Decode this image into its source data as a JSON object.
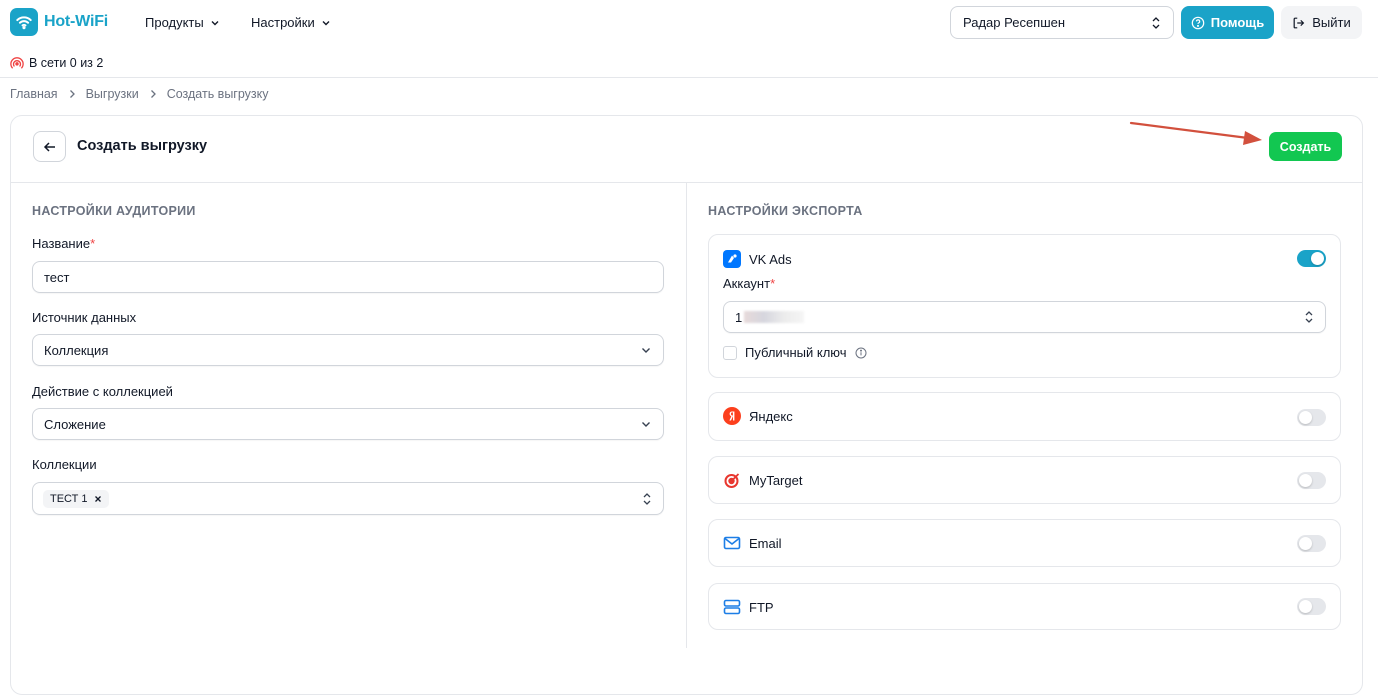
{
  "app": {
    "name": "Hot-WiFi"
  },
  "nav": {
    "products": "Продукты",
    "settings": "Настройки"
  },
  "venue": {
    "selected": "Радар Ресепшен"
  },
  "header": {
    "help": "Помощь",
    "logout": "Выйти"
  },
  "status": {
    "text": "В сети 0 из 2"
  },
  "breadcrumb": {
    "items": [
      "Главная",
      "Выгрузки",
      "Создать выгрузку"
    ]
  },
  "page": {
    "title": "Создать выгрузку",
    "create": "Создать"
  },
  "audience": {
    "title": "НАСТРОЙКИ АУДИТОРИИ",
    "name_label": "Название",
    "name_value": "тест",
    "source_label": "Источник данных",
    "source_value": "Коллекция",
    "action_label": "Действие с коллекцией",
    "action_value": "Сложение",
    "collections_label": "Коллекции",
    "collections_chip": "ТЕСТ 1",
    "required_mark": "*"
  },
  "export": {
    "title": "НАСТРОЙКИ ЭКСПОРТА",
    "vk": {
      "name": "VK Ads",
      "enabled": true,
      "account_label": "Аккаунт",
      "account_value": "1",
      "public_key": "Публичный ключ"
    },
    "yandex": {
      "name": "Яндекс",
      "enabled": false
    },
    "mytarget": {
      "name": "MyTarget",
      "enabled": false
    },
    "email": {
      "name": "Email",
      "enabled": false
    },
    "ftp": {
      "name": "FTP",
      "enabled": false
    }
  },
  "colors": {
    "brand": "#1aa3c8",
    "create": "#12c751",
    "arrow": "#d2503d"
  }
}
